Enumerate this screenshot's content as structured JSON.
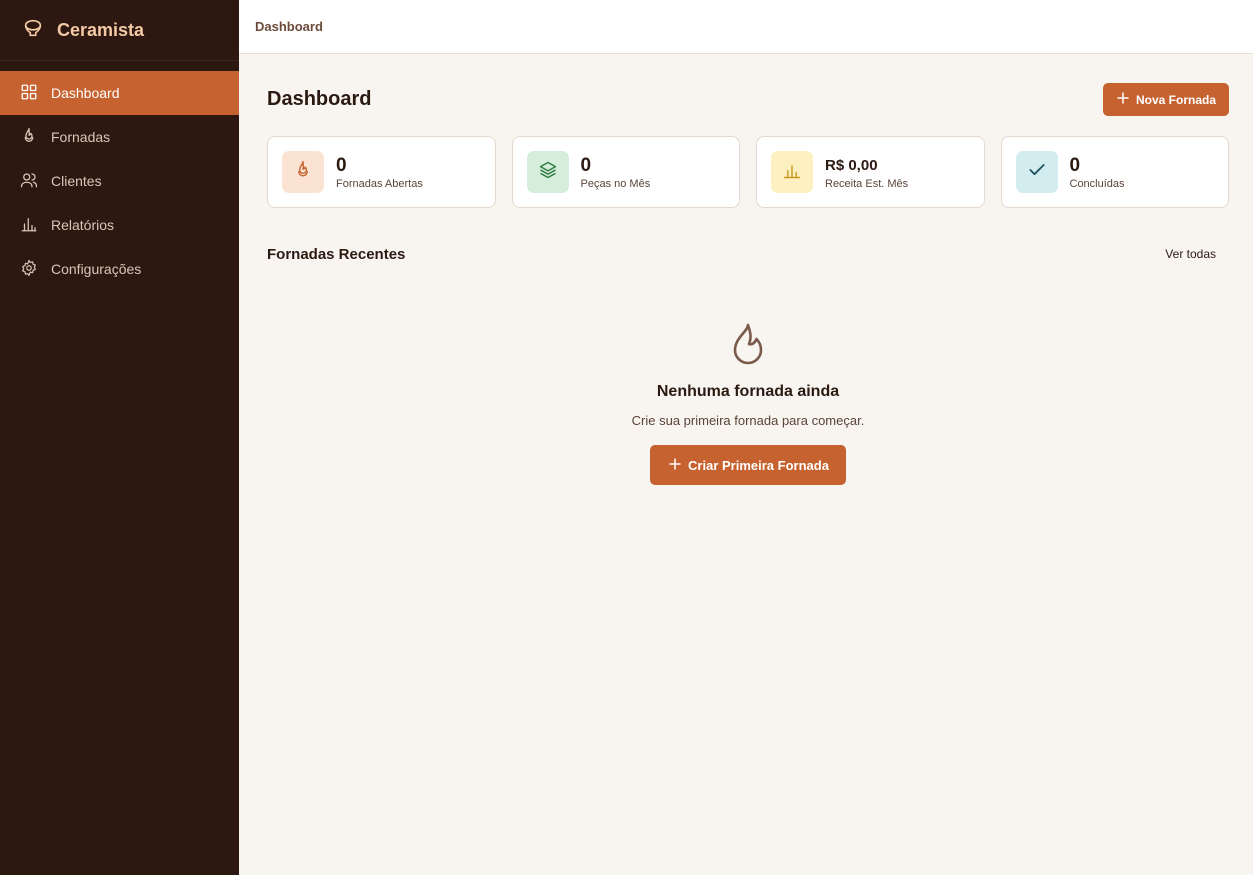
{
  "app": {
    "name": "Ceramista",
    "icon": "pottery-icon"
  },
  "sidebar": {
    "items": [
      {
        "label": "Dashboard",
        "icon": "grid-icon",
        "active": true
      },
      {
        "label": "Fornadas",
        "icon": "flame-icon",
        "active": false
      },
      {
        "label": "Clientes",
        "icon": "users-icon",
        "active": false
      },
      {
        "label": "Relatórios",
        "icon": "bar-chart-icon",
        "active": false
      },
      {
        "label": "Configurações",
        "icon": "gear-icon",
        "active": false
      }
    ]
  },
  "topbar": {
    "breadcrumb": "Dashboard"
  },
  "header": {
    "title": "Dashboard",
    "new_button_label": "Nova Fornada"
  },
  "stats": [
    {
      "value": "0",
      "label": "Fornadas Abertas",
      "icon": "flame-icon",
      "color": "#fbe3d3"
    },
    {
      "value": "0",
      "label": "Peças no Mês",
      "icon": "layers-icon",
      "color": "#d4eedb"
    },
    {
      "value": "R$ 0,00",
      "label": "Receita Est. Mês",
      "icon": "bar-chart-icon",
      "color": "#fcefc0"
    },
    {
      "value": "0",
      "label": "Concluídas",
      "icon": "check-icon",
      "color": "#d2ecf0"
    }
  ],
  "recent": {
    "title": "Fornadas Recentes",
    "see_all": "Ver todas",
    "empty_title": "Nenhuma fornada ainda",
    "empty_subtitle": "Crie sua primeira fornada para começar.",
    "create_button_label": "Criar Primeira Fornada"
  },
  "colors": {
    "sidebar_bg": "#2c1810",
    "accent": "#c6622f",
    "brand_text": "#f3c9a6",
    "page_bg": "#f8f4ef"
  }
}
